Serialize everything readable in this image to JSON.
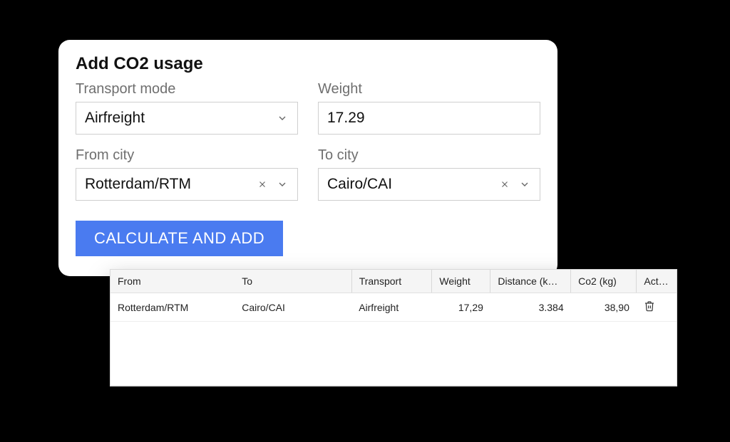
{
  "form": {
    "title": "Add CO2 usage",
    "transport_mode": {
      "label": "Transport mode",
      "value": "Airfreight"
    },
    "weight": {
      "label": "Weight",
      "value": "17.29"
    },
    "from_city": {
      "label": "From city",
      "value": "Rotterdam/RTM"
    },
    "to_city": {
      "label": "To city",
      "value": "Cairo/CAI"
    },
    "calculate_label": "CALCULATE AND ADD"
  },
  "table": {
    "headers": {
      "from": "From",
      "to": "To",
      "transport": "Transport",
      "weight": "Weight",
      "distance": "Distance (k…",
      "co2": "Co2 (kg)",
      "actions": "Act…"
    },
    "rows": [
      {
        "from": "Rotterdam/RTM",
        "to": "Cairo/CAI",
        "transport": "Airfreight",
        "weight": "17,29",
        "distance": "3.384",
        "co2": "38,90"
      }
    ]
  }
}
